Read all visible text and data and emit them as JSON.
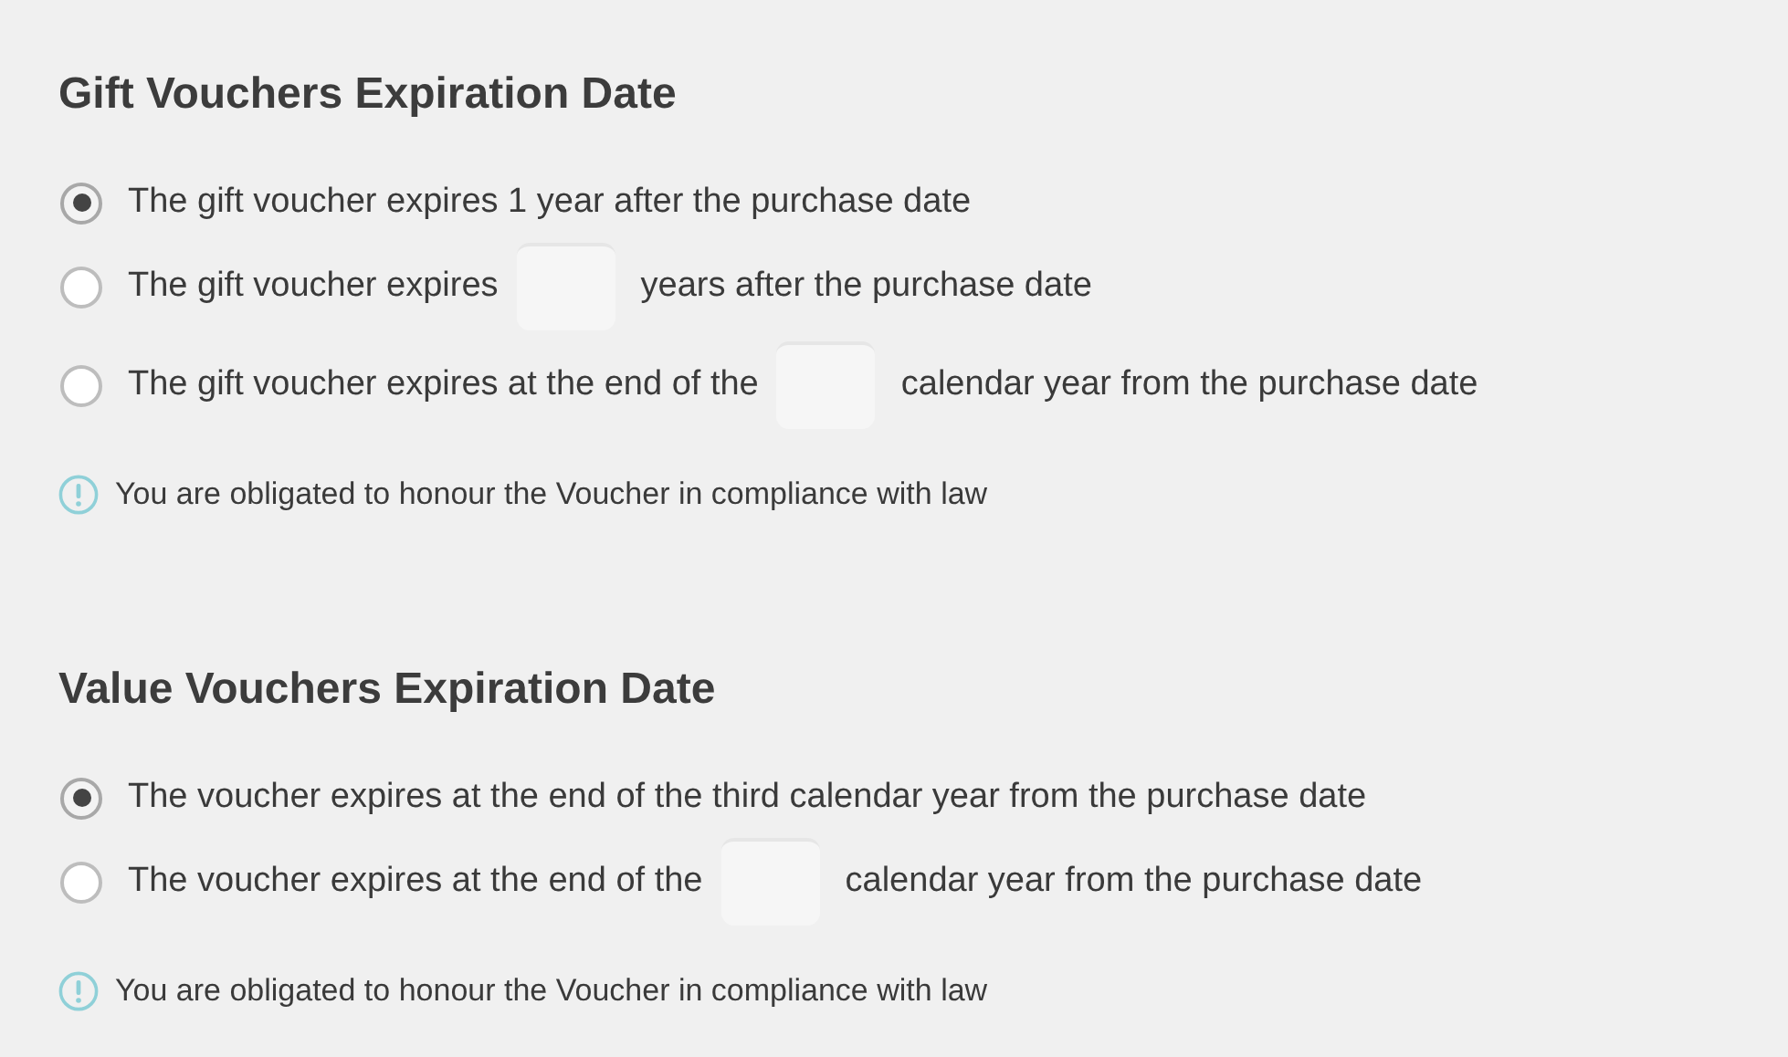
{
  "sections": [
    {
      "title": "Gift Vouchers Expiration Date",
      "options": [
        {
          "kind": "plain",
          "selected": true,
          "text": "The gift voucher expires 1 year after the purchase date"
        },
        {
          "kind": "input",
          "selected": false,
          "before": "The gift voucher expires",
          "after": "years after the purchase date"
        },
        {
          "kind": "input",
          "selected": false,
          "before": "The gift voucher expires at the end of the",
          "after": "calendar year from the purchase date"
        }
      ],
      "notice": "You are obligated to honour the Voucher in compliance with law"
    },
    {
      "title": "Value Vouchers Expiration Date",
      "options": [
        {
          "kind": "plain",
          "selected": true,
          "text": "The voucher expires at the end of the third calendar year from the purchase date"
        },
        {
          "kind": "input",
          "selected": false,
          "before": "The voucher expires at the end of the",
          "after": "calendar year from the purchase date"
        }
      ],
      "notice": "You are obligated to honour the Voucher in compliance with law"
    }
  ]
}
